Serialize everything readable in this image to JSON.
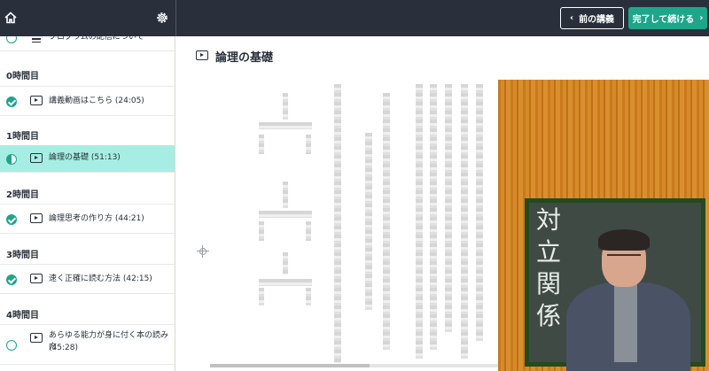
{
  "topbar": {
    "home_icon": "home-icon",
    "settings_icon": "gear-icon",
    "prev_label": "前の講義",
    "next_label": "完了して続ける"
  },
  "sidebar": {
    "intro_item": {
      "title": "プログラムの配信について",
      "status": "empty",
      "type": "document"
    },
    "sections": [
      {
        "title": "0時間目",
        "items": [
          {
            "title": "講義動画はこちら (24:05)",
            "status": "done",
            "type": "video"
          }
        ]
      },
      {
        "title": "1時間目",
        "items": [
          {
            "title": "論理の基礎 (51:13)",
            "status": "in-progress",
            "type": "video",
            "active": true
          }
        ]
      },
      {
        "title": "2時間目",
        "items": [
          {
            "title": "論理思考の作り方 (44:21)",
            "status": "done",
            "type": "video"
          }
        ]
      },
      {
        "title": "3時間目",
        "items": [
          {
            "title": "速く正確に読む方法 (42:15)",
            "status": "done",
            "type": "video"
          }
        ]
      },
      {
        "title": "4時間目",
        "items": [
          {
            "title_line1": "あらゆる能力が身に付く本の読み方",
            "title_line2": "(45:28)",
            "status": "empty",
            "type": "video"
          }
        ]
      }
    ]
  },
  "main": {
    "lecture_title": "論理の基礎",
    "board_text": "対立関係"
  },
  "colors": {
    "topbar": "#29303b",
    "accent": "#1da68a",
    "active_row": "#a6eee3"
  }
}
